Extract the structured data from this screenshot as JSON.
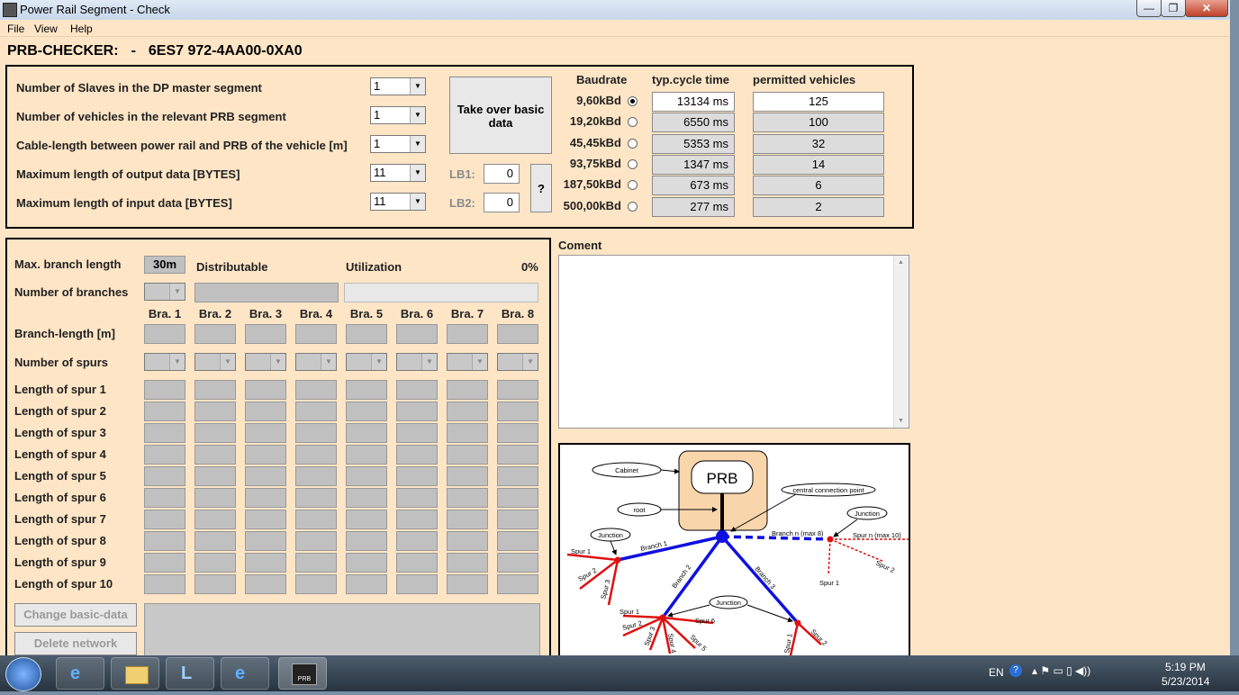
{
  "window": {
    "title": "Power Rail Segment - Check",
    "minimize": "—",
    "maximize": "❐",
    "close": "✕"
  },
  "menu": {
    "file": "File",
    "view": "View",
    "help": "Help"
  },
  "header": {
    "app": "PRB-CHECKER:",
    "sep": "-",
    "part": "6ES7 972-4AA00-0XA0"
  },
  "params": {
    "slaves_label": "Number of Slaves in the DP master segment",
    "slaves_value": "1",
    "vehicles_label": "Number of vehicles in the relevant PRB segment",
    "vehicles_value": "1",
    "cable_label": "Cable-length between power rail and PRB of the vehicle [m]",
    "cable_value": "1",
    "output_label": "Maximum length of output data [BYTES]",
    "output_value": "11",
    "input_label": "Maximum length of input data  [BYTES]",
    "input_value": "11"
  },
  "takeover_button": "Take over basic data",
  "lb": {
    "lb1_label": "LB1:",
    "lb1_value": "0",
    "lb2_label": "LB2:",
    "lb2_value": "0",
    "help_button": "?"
  },
  "baud_table": {
    "headers": [
      "Baudrate",
      "typ.cycle time",
      "permitted vehicles"
    ],
    "rows": [
      {
        "rate": "9,60kBd",
        "cycle": "13134 ms",
        "vehicles": "125",
        "selected": true
      },
      {
        "rate": "19,20kBd",
        "cycle": "6550 ms",
        "vehicles": "100",
        "selected": false
      },
      {
        "rate": "45,45kBd",
        "cycle": "5353 ms",
        "vehicles": "32",
        "selected": false
      },
      {
        "rate": "93,75kBd",
        "cycle": "1347 ms",
        "vehicles": "14",
        "selected": false
      },
      {
        "rate": "187,50kBd",
        "cycle": "673 ms",
        "vehicles": "6",
        "selected": false
      },
      {
        "rate": "500,00kBd",
        "cycle": "277 ms",
        "vehicles": "2",
        "selected": false
      }
    ]
  },
  "branches": {
    "max_label": "Max. branch length",
    "max_value": "30m",
    "distributable": "Distributable",
    "utilization": "Utilization",
    "utilization_pct": "0%",
    "num_label": "Number of branches",
    "columns": [
      "Bra. 1",
      "Bra. 2",
      "Bra. 3",
      "Bra. 4",
      "Bra. 5",
      "Bra. 6",
      "Bra. 7",
      "Bra. 8"
    ],
    "length_label": "Branch-length [m]",
    "spurs_label": "Number of spurs",
    "spur_rows": [
      "Length of spur 1",
      "Length of spur 2",
      "Length of spur 3",
      "Length of spur 4",
      "Length of spur 5",
      "Length of spur 6",
      "Length of spur 7",
      "Length of spur 8",
      "Length of spur 9",
      "Length of spur 10"
    ],
    "change_button": "Change basic-data",
    "delete_button": "Delete network"
  },
  "comment": {
    "label": "Coment"
  },
  "diagram": {
    "prb": "PRB",
    "cabinet": "Cabinet",
    "root": "root",
    "central": "central connection point",
    "junction": "Junction",
    "branch1": "Branch 1",
    "branch2": "Branch 2",
    "branch3": "Branch 3",
    "branchn": "Branch n (max 8)",
    "spurn": "Spur n (max 10)",
    "spur1": "Spur 1",
    "spur2": "Spur 2",
    "spur3": "Spur 3",
    "spur4": "Spur 4",
    "spur5": "Spur 5",
    "spur6": "Spur 6"
  },
  "taskbar": {
    "lang": "EN",
    "time": "5:19 PM",
    "date": "5/23/2014",
    "prb_icon": "PRB"
  }
}
